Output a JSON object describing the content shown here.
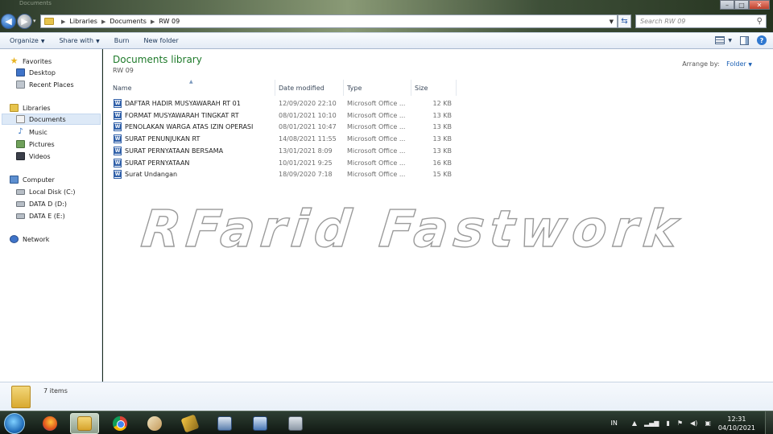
{
  "window": {
    "ghost_title": "Documents",
    "breadcrumb": [
      "Libraries",
      "Documents",
      "RW  09"
    ],
    "search_placeholder": "Search RW  09"
  },
  "toolbar": {
    "organize": "Organize",
    "share_with": "Share with",
    "burn": "Burn",
    "new_folder": "New folder"
  },
  "sidebar": {
    "favorites": "Favorites",
    "desktop": "Desktop",
    "recent_places": "Recent Places",
    "libraries": "Libraries",
    "documents": "Documents",
    "music": "Music",
    "pictures": "Pictures",
    "videos": "Videos",
    "computer": "Computer",
    "local_disk": "Local Disk (C:)",
    "data_d": "DATA D (D:)",
    "data_e": "DATA E (E:)",
    "network": "Network"
  },
  "main": {
    "title": "Documents library",
    "subtitle": "RW  09",
    "arrange_label": "Arrange by:",
    "arrange_value": "Folder",
    "columns": {
      "name": "Name",
      "date": "Date modified",
      "type": "Type",
      "size": "Size"
    },
    "files": [
      {
        "name": "DAFTAR HADIR MUSYAWARAH RT 01",
        "date": "12/09/2020 22:10",
        "type": "Microsoft Office ...",
        "size": "12 KB"
      },
      {
        "name": "FORMAT MUSYAWARAH TINGKAT RT",
        "date": "08/01/2021 10:10",
        "type": "Microsoft Office ...",
        "size": "13 KB"
      },
      {
        "name": "PENOLAKAN WARGA ATAS IZIN OPERASI",
        "date": "08/01/2021 10:47",
        "type": "Microsoft Office ...",
        "size": "13 KB"
      },
      {
        "name": "SURAT PENUNJUKAN RT",
        "date": "14/08/2021 11:55",
        "type": "Microsoft Office ...",
        "size": "13 KB"
      },
      {
        "name": "SURAT PERNYATAAN BERSAMA",
        "date": "13/01/2021 8:09",
        "type": "Microsoft Office ...",
        "size": "13 KB"
      },
      {
        "name": "SURAT PERNYATAAN",
        "date": "10/01/2021 9:25",
        "type": "Microsoft Office ...",
        "size": "16 KB"
      },
      {
        "name": "Surat Undangan",
        "date": "18/09/2020 7:18",
        "type": "Microsoft Office ...",
        "size": "15 KB"
      }
    ],
    "watermark": "RFarid Fastwork"
  },
  "details": {
    "count": "7 items"
  },
  "taskbar": {
    "lang": "IN",
    "time": "12:31",
    "date": "04/10/2021"
  }
}
